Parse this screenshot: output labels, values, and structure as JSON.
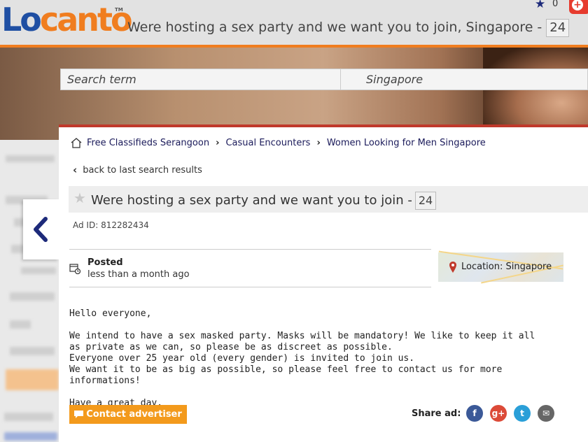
{
  "header": {
    "logo_lo": "Lo",
    "logo_canto": "canto",
    "logo_tm": "TM",
    "title": "Were hosting a sex party and we want you to join, Singapore -",
    "count": "24",
    "favorites_count": "0"
  },
  "search": {
    "term_placeholder": "Search term",
    "location": "Singapore"
  },
  "breadcrumb": {
    "items": [
      "Free Classifieds Serangoon",
      "Casual Encounters",
      "Women Looking for Men Singapore"
    ]
  },
  "back_link": "back to last search results",
  "ad": {
    "title": "Were hosting a sex party and we want you to join -",
    "count": "24",
    "ad_id": "Ad ID: 812282434",
    "posted_label": "Posted",
    "posted_value": "less than a month ago",
    "location_label": "Location: Singapore",
    "description": [
      "Hello everyone,",
      "",
      "We intend to have a sex masked party. Masks will be mandatory! We like to keep it all",
      "as private as we can, so please be as discreet as possible.",
      "Everyone over 25 year old (every gender) is invited to join us.",
      "We want it to be as big as possible, so please feel free to contact us for more informations!",
      "",
      "Have a great day."
    ]
  },
  "actions": {
    "contact_label": "Contact advertiser",
    "share_label": "Share ad:"
  },
  "share_icons": {
    "facebook": "f",
    "google_plus": "g+",
    "twitter": "t",
    "email": "✉"
  },
  "colors": {
    "accent_orange": "#f07d1f",
    "brand_blue": "#1f4fa3",
    "ad_border_red": "#c0392b",
    "button_orange": "#f39a1c"
  }
}
